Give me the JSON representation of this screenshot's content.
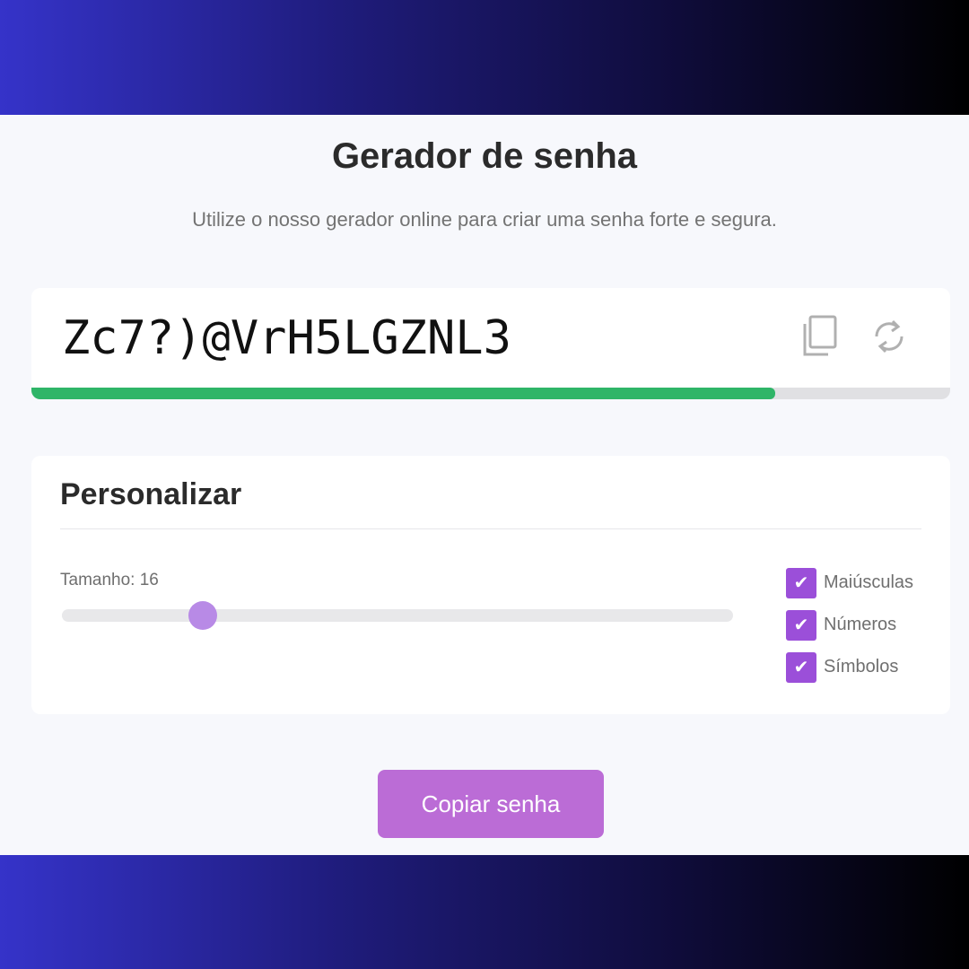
{
  "header": {
    "title": "Gerador de senha",
    "subtitle": "Utilize o nosso gerador online para criar uma senha forte e segura."
  },
  "password": {
    "value": "Zc7?)@VrH5LGZNL3",
    "strength_fraction": 0.81,
    "strength_color": "#2fb568",
    "copy_icon": "copy-icon",
    "refresh_icon": "refresh-icon"
  },
  "customize": {
    "title": "Personalizar",
    "length_label": "Tamanho: 16",
    "slider_fraction": 0.21,
    "options": [
      {
        "label": "Maiúsculas",
        "checked": true
      },
      {
        "label": "Números",
        "checked": true
      },
      {
        "label": "Símbolos",
        "checked": true
      }
    ]
  },
  "actions": {
    "copy_label": "Copiar senha"
  },
  "colors": {
    "accent": "#9b4fd9",
    "button": "#bb6cd6",
    "slider_thumb": "#b88ae6"
  }
}
